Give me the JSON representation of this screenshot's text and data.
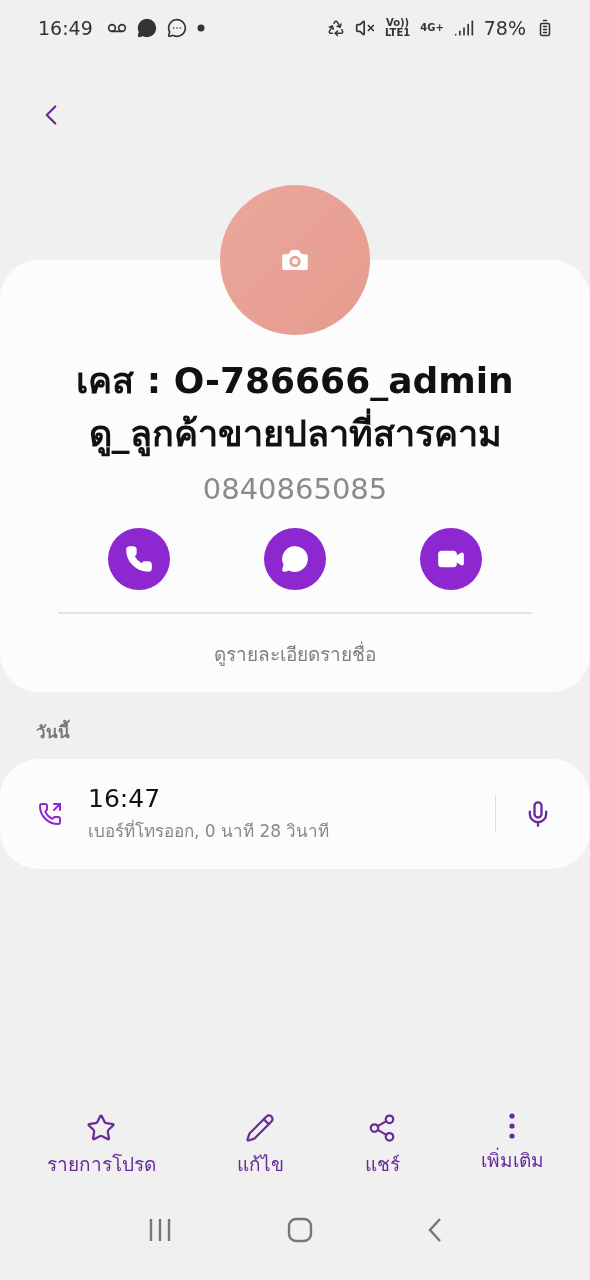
{
  "status_bar": {
    "time": "16:49",
    "volte": "Vo))",
    "lte": "LTE1",
    "network": "4G+",
    "battery": "78%"
  },
  "contact": {
    "name": "เคส : O-786666_adminดู_ลูกค้าขายปลาที่สารคาม",
    "phone": "0840865085",
    "actions": [
      {
        "kind": "call"
      },
      {
        "kind": "message"
      },
      {
        "kind": "video"
      }
    ],
    "details_link": "ดูรายละเอียดรายชื่อ"
  },
  "history": {
    "section": "วันนี้",
    "calls": [
      {
        "kind": "outgoing",
        "time": "16:47",
        "description": "เบอร์ที่โทรออก, 0 นาที 28 วินาที",
        "recorded": true
      }
    ]
  },
  "bottom_actions": [
    {
      "kind": "favorite",
      "label": "รายการโปรด"
    },
    {
      "kind": "edit",
      "label": "แก้ไข"
    },
    {
      "kind": "share",
      "label": "แชร์"
    },
    {
      "kind": "more",
      "label": "เพิ่มเติม"
    }
  ]
}
